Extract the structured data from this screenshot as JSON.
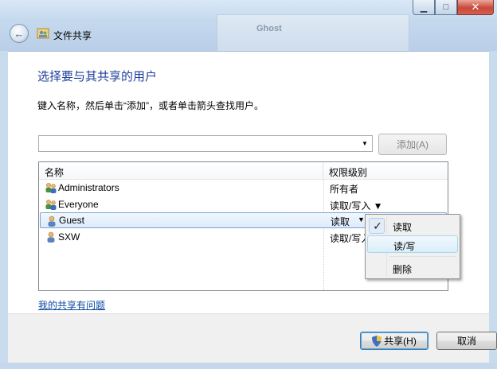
{
  "window": {
    "title": "文件共享",
    "background_window_text": "Ghost",
    "caption_buttons": [
      "minimize",
      "maximize",
      "close"
    ]
  },
  "content": {
    "heading": "选择要与其共享的用户",
    "instruction": "键入名称，然后单击“添加”，或者单击箭头查找用户。",
    "combo_value": "",
    "add_button": "添加(A)"
  },
  "list": {
    "columns": [
      "名称",
      "权限级别"
    ],
    "rows": [
      {
        "name": "Administrators",
        "permission": "所有者",
        "icon": "group-icon"
      },
      {
        "name": "Everyone",
        "permission": "读取/写入 ▼",
        "icon": "group-icon"
      },
      {
        "name": "Guest",
        "permission": "读取",
        "icon": "user-icon",
        "selected": true
      },
      {
        "name": "SXW",
        "permission": "读取/写入",
        "icon": "user-icon"
      }
    ]
  },
  "menu": {
    "items": [
      "读取",
      "读/写",
      "删除"
    ],
    "checked": "读取"
  },
  "help_link": "我的共享有问题",
  "footer": {
    "share_button": "共享(H)",
    "cancel_button": "取消"
  },
  "colors": {
    "heading": "#1e3f9a",
    "link": "#0b4aa3",
    "selection": "#dcebfc"
  }
}
